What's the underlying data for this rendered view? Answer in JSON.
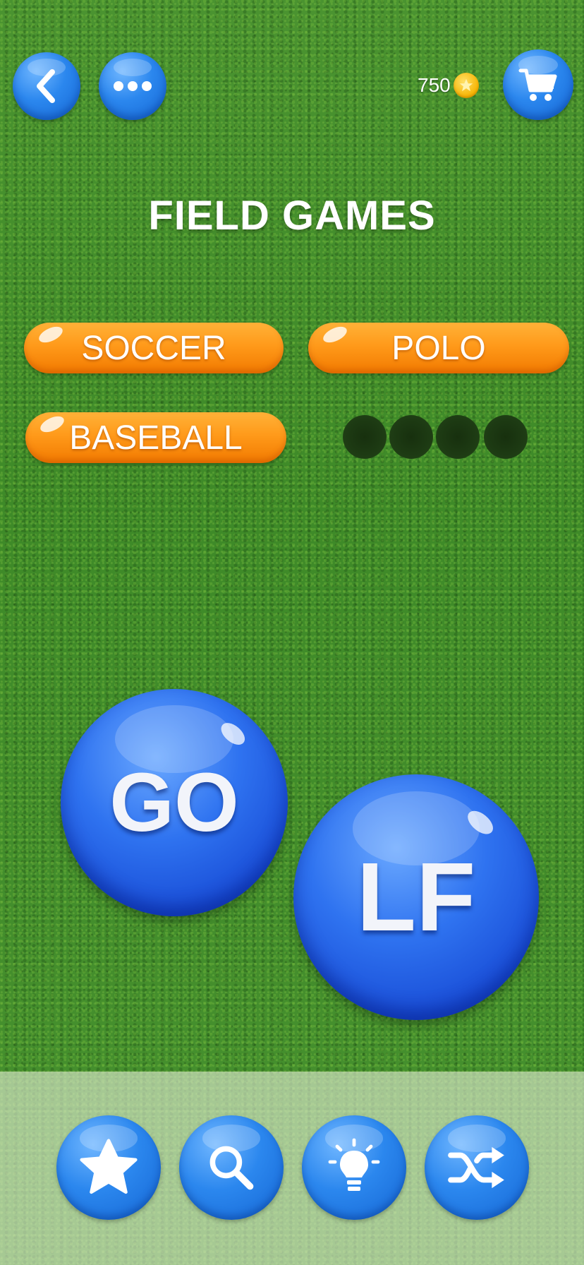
{
  "header": {
    "back_icon": "chevron-left-icon",
    "menu_icon": "more-dots-icon",
    "coins": "750",
    "coin_icon": "star-coin-icon",
    "cart_icon": "shopping-cart-icon"
  },
  "category": {
    "title": "FIELD GAMES"
  },
  "found_words": [
    {
      "label": "SOCCER"
    },
    {
      "label": "POLO"
    },
    {
      "label": "BASEBALL"
    }
  ],
  "remaining_word": {
    "letter_slots": 4
  },
  "letter_bubbles": [
    {
      "letters": "GO"
    },
    {
      "letters": "LF"
    }
  ],
  "toolbar": {
    "items": [
      {
        "icon": "star-icon"
      },
      {
        "icon": "magnifier-icon"
      },
      {
        "icon": "lightbulb-icon"
      },
      {
        "icon": "shuffle-icon"
      }
    ]
  },
  "colors": {
    "button_blue": "#2b87ee",
    "word_orange": "#ff9a1a",
    "grass_green": "#3f8a2a"
  }
}
